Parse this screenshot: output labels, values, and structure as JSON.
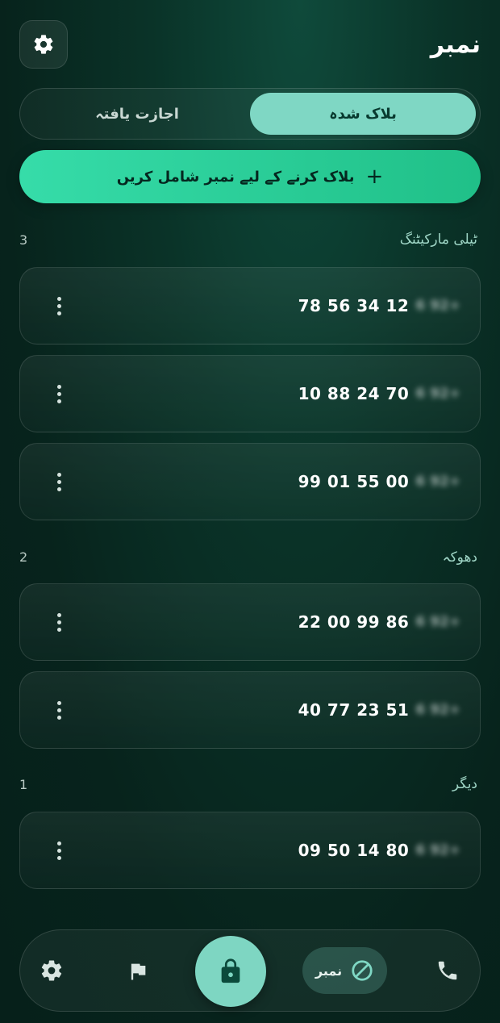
{
  "header": {
    "title": "نمبر",
    "settings_icon": "gear-icon"
  },
  "tabs": [
    {
      "label": "بلاک شدہ",
      "active": true
    },
    {
      "label": "اجازت یافتہ",
      "active": false
    }
  ],
  "add_button": {
    "label": "بلاک کرنے کے لیے نمبر شامل کریں",
    "icon": "+"
  },
  "groups": [
    {
      "name": "ٹیلی مارکیٹنگ",
      "count": "3",
      "items": [
        {
          "number": "78 56 34 12",
          "prefix_blurred": "6 92+"
        },
        {
          "number": "10 88 24 70",
          "prefix_blurred": "6 92+"
        },
        {
          "number": "99 01 55 00",
          "prefix_blurred": "6 92+"
        }
      ]
    },
    {
      "name": "دھوکہ",
      "count": "2",
      "items": [
        {
          "number": "22 00 99 86",
          "prefix_blurred": "6 92+"
        },
        {
          "number": "40 77 23 51",
          "prefix_blurred": "6 92+"
        }
      ]
    },
    {
      "name": "دیگر",
      "count": "1",
      "items": [
        {
          "number": "09 50 14 80",
          "prefix_blurred": "6 92+"
        }
      ]
    }
  ],
  "bottom_nav": {
    "items": [
      "gear-icon",
      "flag-icon",
      "lock-icon",
      "block-icon",
      "phone-icon"
    ],
    "active_label": "نمبر"
  },
  "colors": {
    "accent": "#7fd7c4",
    "add_button": "#2ed39e",
    "background": "#07231c"
  }
}
